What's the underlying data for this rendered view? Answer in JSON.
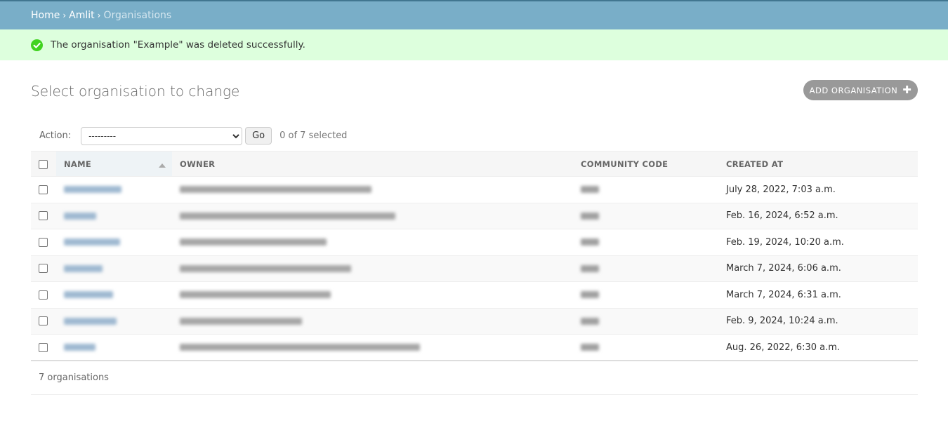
{
  "breadcrumbs": [
    {
      "label": "Home"
    },
    {
      "label": "Amlit"
    },
    {
      "label": "Organisations"
    }
  ],
  "breadcrumb_separator": "›",
  "message": {
    "text": "The organisation \"Example\" was deleted successfully.",
    "icon": "check-circle-icon",
    "color": "#41d321"
  },
  "page": {
    "title": "Select organisation to change",
    "add_button_label": "ADD ORGANISATION",
    "add_button_icon": "plus-icon"
  },
  "actions": {
    "label": "Action:",
    "select_value": "---------",
    "go_label": "Go",
    "selected_count": "0 of 7 selected"
  },
  "table": {
    "columns": [
      "NAME",
      "OWNER",
      "COMMUNITY CODE",
      "CREATED AT"
    ],
    "sorted_column": "NAME",
    "sort_direction": "ascending",
    "rows": [
      {
        "name_blur": 0.82,
        "owner_blur": 0.47,
        "code_blur": 0.12,
        "created_at": "July 28, 2022, 7:03 a.m."
      },
      {
        "name_blur": 0.46,
        "owner_blur": 0.53,
        "code_blur": 0.12,
        "created_at": "Feb. 16, 2024, 6:52 a.m."
      },
      {
        "name_blur": 0.8,
        "owner_blur": 0.36,
        "code_blur": 0.12,
        "created_at": "Feb. 19, 2024, 10:20 a.m."
      },
      {
        "name_blur": 0.55,
        "owner_blur": 0.42,
        "code_blur": 0.12,
        "created_at": "March 7, 2024, 6:06 a.m."
      },
      {
        "name_blur": 0.7,
        "owner_blur": 0.37,
        "code_blur": 0.12,
        "created_at": "March 7, 2024, 6:31 a.m."
      },
      {
        "name_blur": 0.75,
        "owner_blur": 0.3,
        "code_blur": 0.12,
        "created_at": "Feb. 9, 2024, 10:24 a.m."
      },
      {
        "name_blur": 0.45,
        "owner_blur": 0.59,
        "code_blur": 0.12,
        "created_at": "Aug. 26, 2022, 6:30 a.m."
      }
    ]
  },
  "paginator": {
    "text": "7 organisations"
  },
  "colors": {
    "header_bg": "#79aec8",
    "message_bg": "#dfd",
    "link": "#447e9b"
  }
}
